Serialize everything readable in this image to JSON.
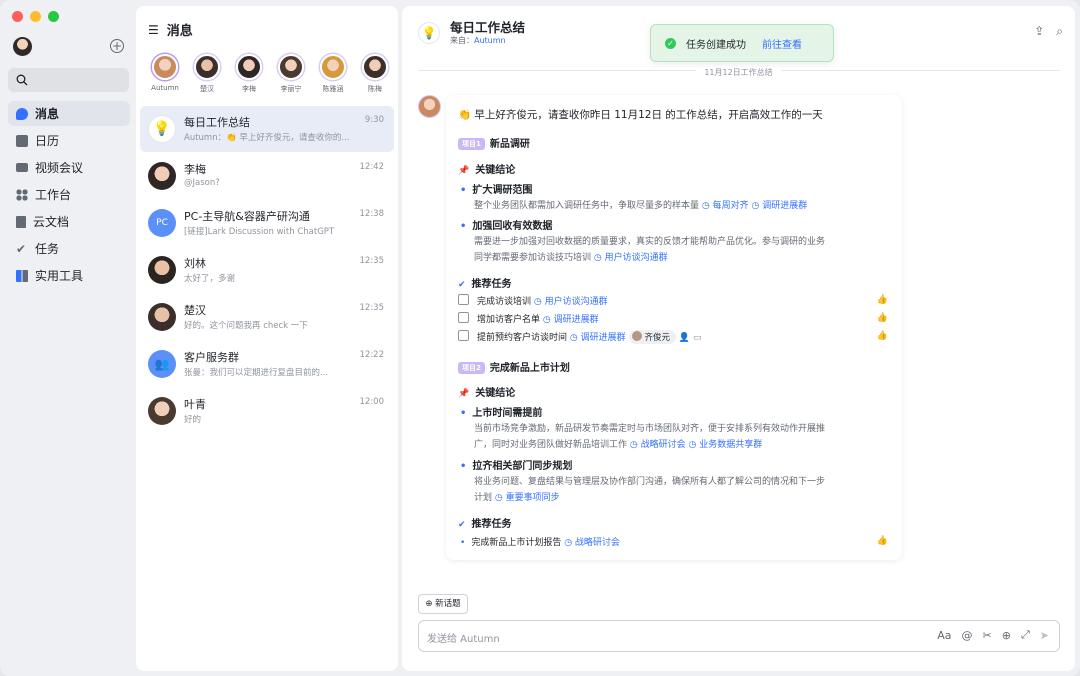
{
  "nav": {
    "items": [
      {
        "label": "消息",
        "icon": "chat-bubble-icon",
        "active": true
      },
      {
        "label": "日历",
        "icon": "calendar-icon"
      },
      {
        "label": "视频会议",
        "icon": "video-icon"
      },
      {
        "label": "工作台",
        "icon": "grid-icon"
      },
      {
        "label": "云文档",
        "icon": "document-icon"
      },
      {
        "label": "任务",
        "icon": "checkmark-icon"
      },
      {
        "label": "实用工具",
        "icon": "tools-icon"
      }
    ]
  },
  "chatlist": {
    "title": "消息",
    "contacts": [
      {
        "name": "Autumn",
        "color": "#c9b8f5"
      },
      {
        "name": "楚汉",
        "color": "#7a5a4a"
      },
      {
        "name": "李梅",
        "color": "#5b4b45"
      },
      {
        "name": "李丽宁",
        "color": "#7d6150"
      },
      {
        "name": "陈雅涵",
        "color": "#d59a4e"
      },
      {
        "name": "陈梅",
        "color": "#6a5048"
      }
    ],
    "chats": [
      {
        "title": "每日工作总结",
        "sub": "Autumn：👏 早上好齐俊元，请查收你的...",
        "time": "9:30"
      },
      {
        "title": "李梅",
        "sub": "@Jason?",
        "time": "12:42"
      },
      {
        "title": "PC-主导航&容器产研沟通",
        "sub": "[链接]Lark Discussion with ChatGPT",
        "time": "12:38"
      },
      {
        "title": "刘林",
        "sub": "太好了，多谢",
        "time": "12:35"
      },
      {
        "title": "楚汉",
        "sub": "好的。这个问题我再 check 一下",
        "time": "12:35"
      },
      {
        "title": "客户服务群",
        "sub": "张曼：我们可以定期进行复盘目前的...",
        "time": "12:22"
      },
      {
        "title": "叶青",
        "sub": "好的",
        "time": "12:00"
      }
    ]
  },
  "main": {
    "title": "每日工作总结",
    "source_prefix": "来自：",
    "source_name": "Autumn",
    "toast_text": "任务创建成功",
    "toast_link": "前往查看",
    "date_divider": "11月12日工作总结",
    "card": {
      "greeting": "👏 早上好齐俊元，请查收你昨日 11月12日 的工作总结，开启高效工作的一天",
      "p1_tag": "项目1",
      "p1_title": "新品调研",
      "key_conclusion": "关键结论",
      "p1_c1_title": "扩大调研范围",
      "p1_c1_text": "整个业务团队都需加入调研任务中，争取尽量多的样本量",
      "p1_c1_link1": "每周对齐",
      "p1_c1_link2": "调研进展群",
      "p1_c2_title": "加强回收有效数据",
      "p1_c2_text1": "需要进一步加强对回收数据的质量要求，真实的反馈才能帮助产品优化。参与调研的业务",
      "p1_c2_text2": "同学都需要参加访谈技巧培训",
      "p1_c2_link": "用户访谈沟通群",
      "rec_tasks": "推荐任务",
      "t1": "完成访谈培训",
      "t1_link": "用户访谈沟通群",
      "t2": "增加访客户名单",
      "t2_link": "调研进展群",
      "t3": "提前预约客户访谈时间",
      "t3_link": "调研进展群",
      "t3_chip": "齐俊元",
      "p2_tag": "项目2",
      "p2_title": "完成新品上市计划",
      "p2_c1_title": "上市时间需提前",
      "p2_c1_text1": "当前市场竞争激励，新品研发节奏需定时与市场团队对齐，便于安排系列有效动作开展推",
      "p2_c1_text2": "广，同时对业务团队做好新品培训工作",
      "p2_c1_link1": "战略研讨会",
      "p2_c1_link2": "业务数据共享群",
      "p2_c2_title": "拉齐相关部门同步规划",
      "p2_c2_text1": "将业务问题、复盘结果与管理层及协作部门沟通，确保所有人都了解公司的情况和下一步",
      "p2_c2_text2": "计划",
      "p2_c2_link": "重要事项同步",
      "p2_t1": "完成新品上市计划报告",
      "p2_t1_link": "战略研讨会"
    },
    "new_topic": "新话题",
    "input_placeholder": "发送给 Autumn",
    "accent": "#3370ff"
  }
}
